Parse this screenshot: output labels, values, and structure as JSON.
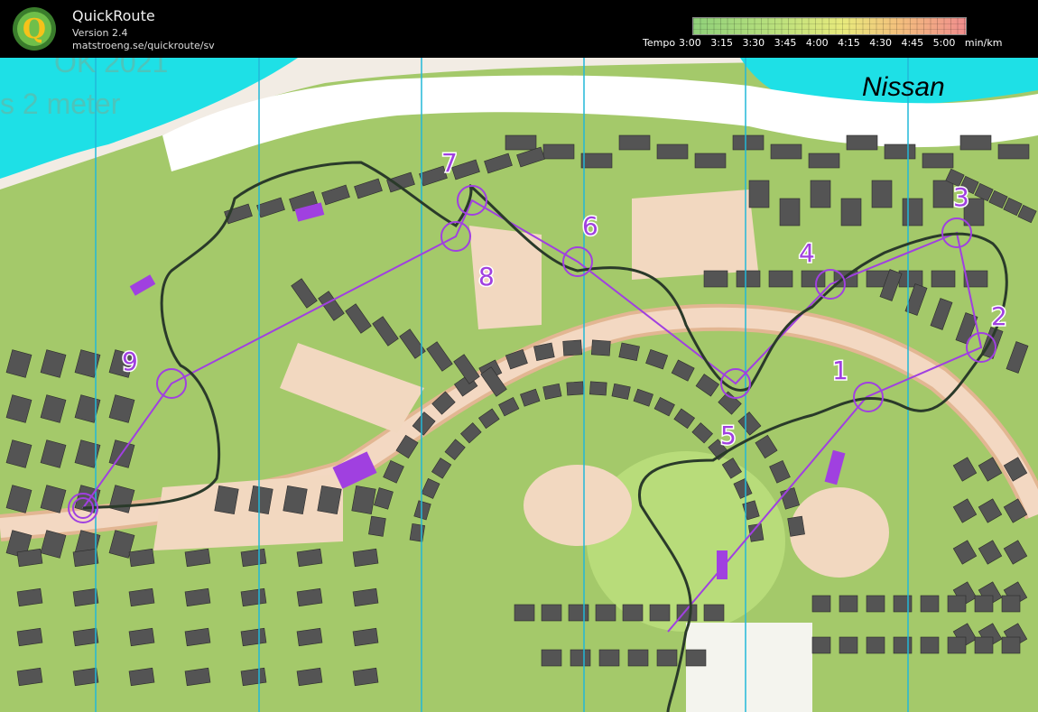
{
  "app": {
    "title": "QuickRoute",
    "version": "Version 2.4",
    "url": "matstroeng.se/quickroute/sv"
  },
  "tempo_legend": {
    "prefix": "Tempo",
    "labels": [
      "3:00",
      "3:15",
      "3:30",
      "3:45",
      "4:00",
      "4:15",
      "4:30",
      "4:45",
      "5:00"
    ],
    "unit": "min/km",
    "colors": {
      "fast": "#8fd07a",
      "mid": "#e8ea7c",
      "slow": "#f08d8d"
    }
  },
  "map": {
    "place_label": "Nissan",
    "background_text_lines": [
      "OK 2021",
      "s 2 meter"
    ],
    "controls": [
      {
        "label": "1"
      },
      {
        "label": "2"
      },
      {
        "label": "3"
      },
      {
        "label": "4"
      },
      {
        "label": "5"
      },
      {
        "label": "6"
      },
      {
        "label": "7"
      },
      {
        "label": "8"
      },
      {
        "label": "9"
      }
    ],
    "colors": {
      "water": "#1ee0e6",
      "grass": "#a4c96a",
      "open": "#f2d8c0",
      "building": "#545454",
      "course": "#a040e0",
      "route": "#2a3a2a"
    }
  }
}
